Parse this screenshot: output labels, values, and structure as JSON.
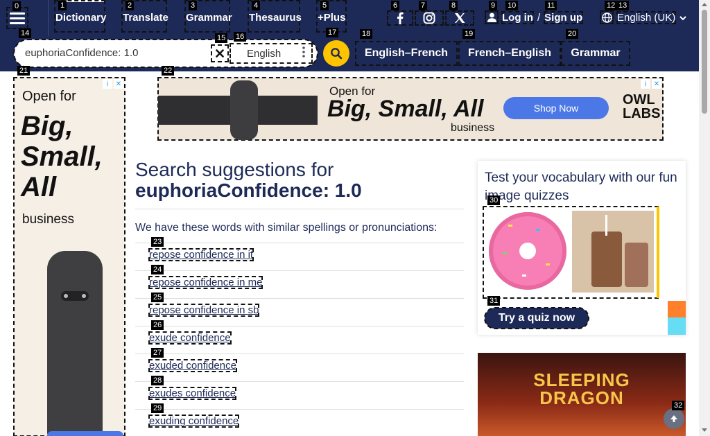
{
  "header": {
    "nav": [
      {
        "label": "Dictionary",
        "tag": "1"
      },
      {
        "label": "Translate",
        "tag": "2"
      },
      {
        "label": "Grammar",
        "tag": "3"
      },
      {
        "label": "Thesaurus",
        "tag": "4"
      },
      {
        "label": "+Plus",
        "tag": "5"
      }
    ],
    "menu_tag": "0",
    "social_tags": [
      "6",
      "7",
      "8"
    ],
    "login": {
      "user_tag": "9",
      "login_label": "Log in",
      "login_tag": "10",
      "separator": "/",
      "signup_label": "Sign up",
      "signup_tag": "11"
    },
    "language": {
      "label": "English (UK)",
      "globe_tag": "12",
      "label_tag": "13"
    }
  },
  "search": {
    "value": "euphoriaConfidence: 1.0",
    "search_tag": "14",
    "clear_tag": "15",
    "language": "English",
    "language_tag": "16",
    "submit_tag": "17"
  },
  "dictionary_links": [
    {
      "label": "English–French",
      "tag": "18"
    },
    {
      "label": "French–English",
      "tag": "19"
    },
    {
      "label": "Grammar",
      "tag": "20"
    }
  ],
  "ads": {
    "left": {
      "tag": "21",
      "line1": "Open for",
      "line2": "Big,",
      "line3": "Small,",
      "line4": "All",
      "line5": "business"
    },
    "top": {
      "tag": "22",
      "line1": "Open for",
      "line2": "Big, Small, All",
      "line3": "business",
      "cta": "Shop Now",
      "brand1": "OWL",
      "brand2": "LABS"
    },
    "right": {
      "title1": "SLEEPING",
      "title2": "DRAGON"
    },
    "choice_i": "i",
    "choice_x": "✕"
  },
  "main": {
    "title_prefix": "Search suggestions for",
    "title_query": "euphoriaConfidence: 1.0",
    "intro": "We have these words with similar spellings or pronunciations:",
    "suggestions": [
      {
        "text": "repose confidence in it",
        "tag": "23"
      },
      {
        "text": "repose confidence in me",
        "tag": "24"
      },
      {
        "text": "repose confidence in sb",
        "tag": "25"
      },
      {
        "text": "exude confidence",
        "tag": "26"
      },
      {
        "text": "exuded confidence",
        "tag": "27"
      },
      {
        "text": "exudes confidence",
        "tag": "28"
      },
      {
        "text": "exuding confidence",
        "tag": "29"
      }
    ]
  },
  "quiz": {
    "title": "Test your vocabulary with our fun image quizzes",
    "images_tag": "30",
    "button_label": "Try a quiz now",
    "button_tag": "31"
  },
  "back_to_top_tag": "32",
  "colors": {
    "navy": "#1d2a57",
    "accent": "#fec400"
  }
}
